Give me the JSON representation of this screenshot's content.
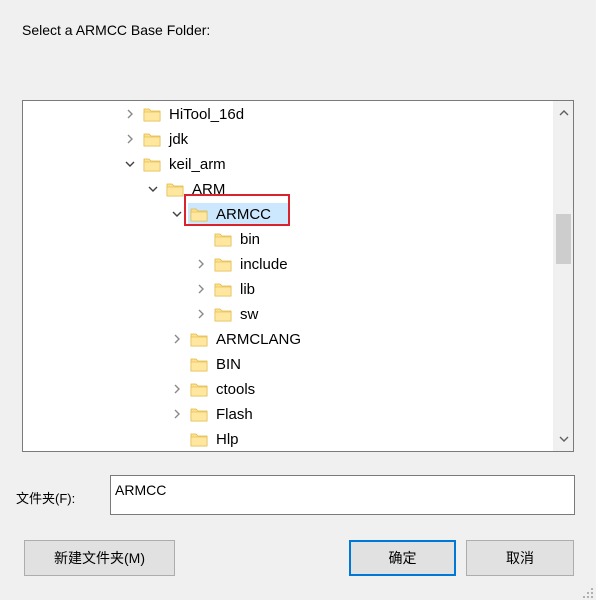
{
  "prompt": "Select a ARMCC Base Folder:",
  "tree": [
    {
      "label": "HiTool_16d",
      "expander": "collapsed"
    },
    {
      "label": "jdk",
      "expander": "collapsed"
    },
    {
      "label": "keil_arm",
      "expander": "expanded"
    },
    {
      "label": "ARM",
      "expander": "expanded"
    },
    {
      "label": "ARMCC",
      "expander": "expanded",
      "selected": true
    },
    {
      "label": "bin",
      "expander": "none"
    },
    {
      "label": "include",
      "expander": "collapsed"
    },
    {
      "label": "lib",
      "expander": "collapsed"
    },
    {
      "label": "sw",
      "expander": "collapsed"
    },
    {
      "label": "ARMCLANG",
      "expander": "collapsed"
    },
    {
      "label": "BIN",
      "expander": "none"
    },
    {
      "label": "ctools",
      "expander": "collapsed"
    },
    {
      "label": "Flash",
      "expander": "collapsed"
    },
    {
      "label": "Hlp",
      "expander": "none"
    }
  ],
  "folder_field": {
    "label": "文件夹(F):",
    "value": "ARMCC"
  },
  "buttons": {
    "new_folder": "新建文件夹(M)",
    "ok": "确定",
    "cancel": "取消"
  },
  "colors": {
    "selection": "#cce8ff",
    "highlight_box": "#d9232d",
    "primary_border": "#0078d7",
    "folder_fill": "#ffe08c"
  },
  "icons": {
    "folder": "folder-icon",
    "chevron_right": "chevron-right-icon",
    "chevron_down": "chevron-down-icon",
    "scroll_up": "scroll-up-icon",
    "scroll_down": "scroll-down-icon",
    "resize_grip": "resize-grip-icon"
  }
}
